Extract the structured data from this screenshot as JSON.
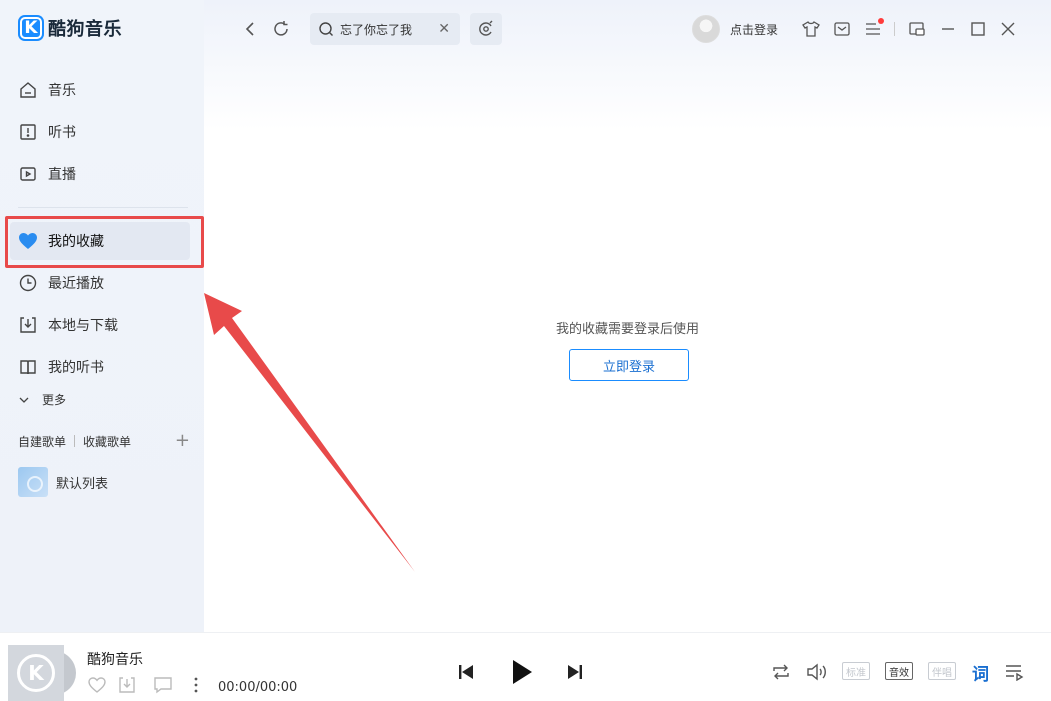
{
  "app": {
    "name": "酷狗音乐",
    "logo_letter": "K"
  },
  "sidebar": {
    "nav": [
      {
        "label": "音乐",
        "icon": "home-icon"
      },
      {
        "label": "听书",
        "icon": "book-icon"
      },
      {
        "label": "直播",
        "icon": "video-icon"
      }
    ],
    "library": [
      {
        "label": "我的收藏",
        "icon": "heart-icon",
        "active": true
      },
      {
        "label": "最近播放",
        "icon": "clock-icon"
      },
      {
        "label": "本地与下载",
        "icon": "download-icon"
      },
      {
        "label": "我的听书",
        "icon": "open-book-icon"
      }
    ],
    "more_label": "更多",
    "playlist_tabs": {
      "created": "自建歌单",
      "collected": "收藏歌单"
    },
    "playlists": [
      {
        "label": "默认列表"
      }
    ]
  },
  "topbar": {
    "search_value": "忘了你忘了我",
    "login_label": "点击登录"
  },
  "main": {
    "empty_message": "我的收藏需要登录后使用",
    "login_button": "立即登录"
  },
  "player": {
    "song_title": "酷狗音乐",
    "time": "00:00/00:00",
    "quality_label": "标准",
    "effect_label": "音效",
    "accompany_label": "伴唱",
    "lyric_label": "词"
  },
  "colors": {
    "accent": "#1a8cff",
    "annotation_red": "#e84a4a"
  }
}
